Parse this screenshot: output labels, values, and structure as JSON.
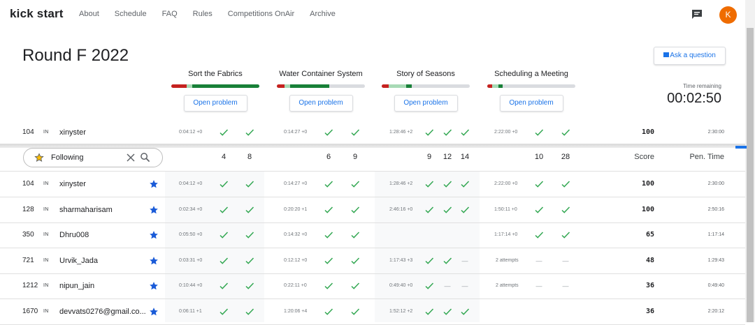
{
  "nav": {
    "brand": "kick start",
    "links": [
      "About",
      "Schedule",
      "FAQ",
      "Rules",
      "Competitions OnAir",
      "Archive"
    ],
    "avatar_letter": "K",
    "avatar_color": "#ef6c00"
  },
  "header": {
    "round_title": "Round F 2022",
    "ask_label": "Ask a question",
    "time_remaining_label": "Time remaining",
    "time_remaining_value": "00:02:50"
  },
  "problems": [
    {
      "name": "Sort the Fabrics",
      "open_label": "Open problem"
    },
    {
      "name": "Water Container System",
      "open_label": "Open problem"
    },
    {
      "name": "Story of Seasons",
      "open_label": "Open problem"
    },
    {
      "name": "Scheduling a Meeting",
      "open_label": "Open problem"
    }
  ],
  "filter": {
    "value": "Following",
    "counts": [
      "4",
      "8",
      "6",
      "9",
      "9",
      "12",
      "14",
      "10",
      "28"
    ],
    "score_header": "Score",
    "penalty_header": "Pen. Time"
  },
  "pinned": {
    "rank": "104",
    "country": "IN",
    "name": "xinyster",
    "times": [
      "0:04:12 +0",
      "0:14:27 +0",
      "1:28:46 +2",
      "2:22:00 +0"
    ],
    "score": "100",
    "penalty": "2:30:00"
  },
  "rows": [
    {
      "rank": "104",
      "country": "IN",
      "name": "xinyster",
      "t1": "0:04:12 +0",
      "t2": "0:14:27 +0",
      "t3": "1:28:46 +2",
      "t4": "2:22:00 +0",
      "score": "100",
      "penalty": "2:30:00"
    },
    {
      "rank": "128",
      "country": "IN",
      "name": "sharmaharisam",
      "t1": "0:02:34 +0",
      "t2": "0:20:20 +1",
      "t3": "2:46:16 +0",
      "t4": "1:50:11 +0",
      "score": "100",
      "penalty": "2:50:16"
    },
    {
      "rank": "350",
      "country": "IN",
      "name": "Dhru008",
      "t1": "0:05:50 +0",
      "t2": "0:14:32 +0",
      "t3": "",
      "t4": "1:17:14 +0",
      "score": "65",
      "penalty": "1:17:14"
    },
    {
      "rank": "721",
      "country": "IN",
      "name": "Urvik_Jada",
      "t1": "0:03:31 +0",
      "t2": "0:12:12 +0",
      "t3": "1:17:43 +3",
      "t4": "2 attempts",
      "score": "48",
      "penalty": "1:29:43"
    },
    {
      "rank": "1212",
      "country": "IN",
      "name": "nipun_jain",
      "t1": "0:10:44 +0",
      "t2": "0:22:11 +0",
      "t3": "0:49:40 +0",
      "t4": "2 attempts",
      "score": "36",
      "penalty": "0:49:40"
    },
    {
      "rank": "1670",
      "country": "IN",
      "name": "devvats0276@gmail.co...",
      "t1": "0:06:11 +1",
      "t2": "1:20:06 +4",
      "t3": "1:52:12 +2",
      "t4": "",
      "score": "36",
      "penalty": "2:20:12"
    }
  ],
  "colors": {
    "accent": "#1a73e8",
    "check": "#34a853",
    "bar_red": "#c5221f",
    "bar_green": "#188038",
    "bar_light": "#a8dab5"
  }
}
